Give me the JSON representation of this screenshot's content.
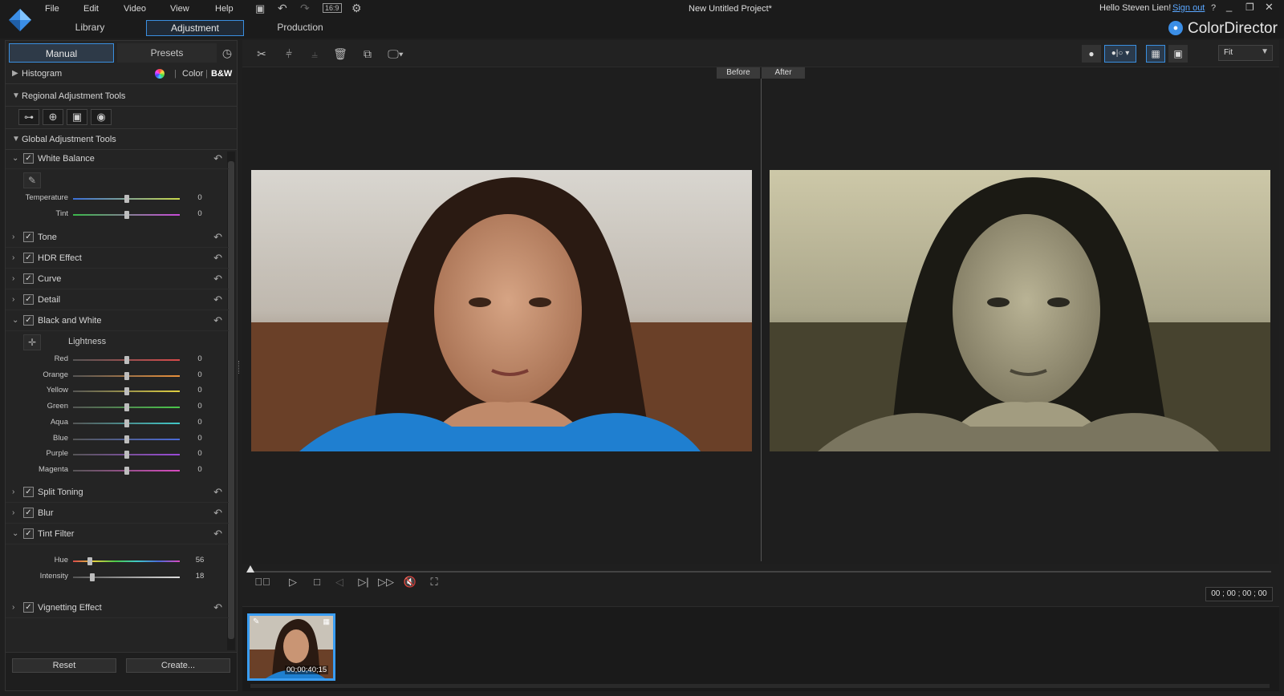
{
  "app": {
    "name": "ColorDirector",
    "project_title": "New Untitled Project*",
    "greeting": "Hello Steven Lien!",
    "sign_out": "Sign out",
    "help": "?"
  },
  "menu": [
    "File",
    "Edit",
    "Video",
    "View",
    "Help"
  ],
  "aspect_label": "16:9",
  "nav_tabs": [
    "Library",
    "Adjustment",
    "Production"
  ],
  "left": {
    "tabs": [
      "Manual",
      "Presets"
    ],
    "histogram": {
      "label": "Histogram",
      "color": "Color",
      "bw": "B&W"
    },
    "regional": {
      "label": "Regional Adjustment Tools"
    },
    "global": {
      "label": "Global Adjustment Tools"
    },
    "white_balance": {
      "label": "White Balance",
      "sliders": [
        {
          "label": "Temperature",
          "value": "0",
          "pos": 0.5
        },
        {
          "label": "Tint",
          "value": "0",
          "pos": 0.5
        }
      ]
    },
    "collapsed_a": [
      "Tone",
      "HDR Effect",
      "Curve",
      "Detail"
    ],
    "black_white": {
      "label": "Black and White",
      "lightness": "Lightness",
      "sliders": [
        {
          "label": "Red",
          "value": "0",
          "pos": 0.5
        },
        {
          "label": "Orange",
          "value": "0",
          "pos": 0.5
        },
        {
          "label": "Yellow",
          "value": "0",
          "pos": 0.5
        },
        {
          "label": "Green",
          "value": "0",
          "pos": 0.5
        },
        {
          "label": "Aqua",
          "value": "0",
          "pos": 0.5
        },
        {
          "label": "Blue",
          "value": "0",
          "pos": 0.5
        },
        {
          "label": "Purple",
          "value": "0",
          "pos": 0.5
        },
        {
          "label": "Magenta",
          "value": "0",
          "pos": 0.5
        }
      ]
    },
    "collapsed_b": [
      "Split Toning",
      "Blur"
    ],
    "tint_filter": {
      "label": "Tint Filter",
      "sliders": [
        {
          "label": "Hue",
          "value": "56",
          "pos": 0.16
        },
        {
          "label": "Intensity",
          "value": "18",
          "pos": 0.18
        }
      ]
    },
    "vignetting": "Vignetting Effect",
    "reset": "Reset",
    "create": "Create..."
  },
  "preview": {
    "before": "Before",
    "after": "After",
    "zoom": "Fit",
    "timecode": "00 ; 00 ; 00 ; 00",
    "playhead_progress": 0.0
  },
  "clip": {
    "duration": "00;00;40;15"
  },
  "colors": {
    "accent": "#3a8fe0",
    "panel": "#242424",
    "background": "#1f1f1f"
  }
}
